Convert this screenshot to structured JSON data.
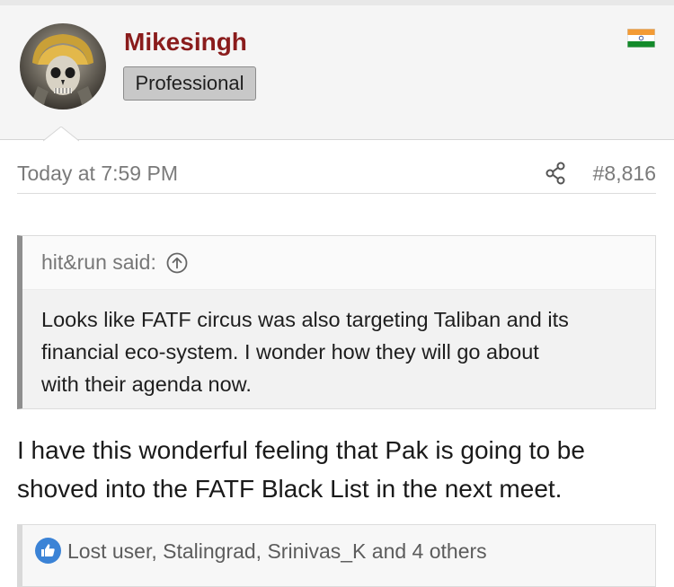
{
  "user": {
    "name": "Mikesingh",
    "title": "Professional",
    "flag_icon": "india-flag-icon"
  },
  "post": {
    "timestamp": "Today at 7:59 PM",
    "number": "#8,816",
    "share_icon": "share-icon"
  },
  "quote": {
    "author": "hit&run said:",
    "lines": [
      "Looks like FATF circus was also targeting Taliban and its",
      "financial eco-system. I wonder how they will go about",
      "with their agenda now."
    ]
  },
  "message": {
    "lines": [
      "I have this wonderful feeling that Pak is going to be",
      "shoved into the FATF Black List in the next meet."
    ]
  },
  "reactions": {
    "text": "Lost user, Stalingrad, Srinivas_K and 4 others",
    "icon": "like-icon"
  },
  "colors": {
    "username": "#8a1c1c",
    "like_blue": "#3b83d6"
  }
}
